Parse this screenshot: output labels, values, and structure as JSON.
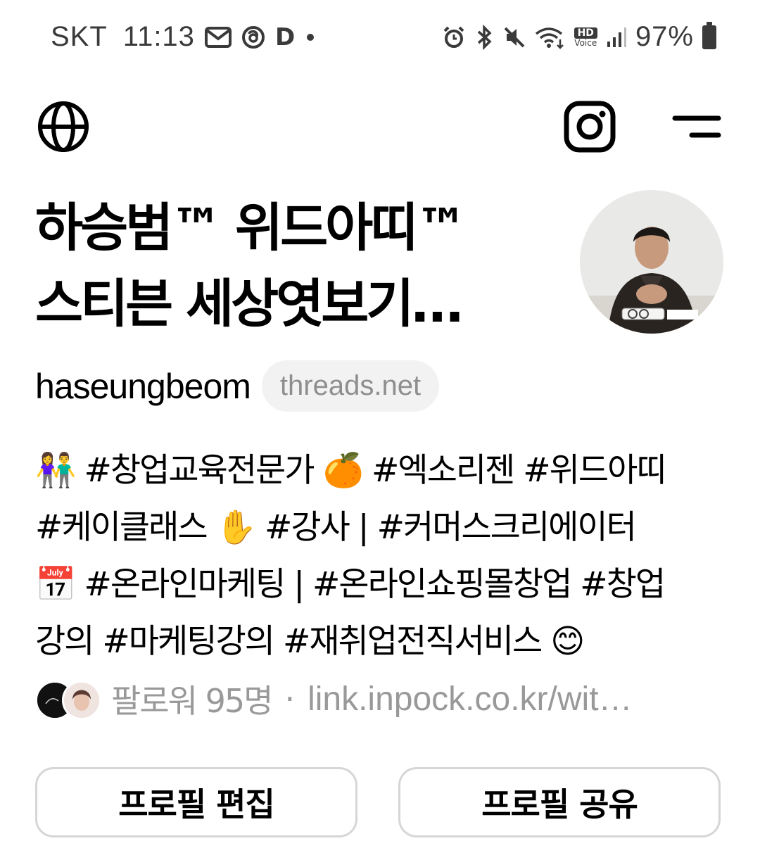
{
  "status_bar": {
    "carrier": "SKT",
    "time": "11:13",
    "d_badge": "D",
    "hd_voice_top": "HD",
    "hd_voice_bottom": "Voice",
    "battery": "97%"
  },
  "top_nav": {
    "language_icon": "globe-icon",
    "instagram_icon": "instagram-icon",
    "menu_icon": "menu-icon"
  },
  "profile": {
    "name_line1": "하승범™ 위드아띠™",
    "name_line2": "스티븐 세상엿보기…",
    "handle": "haseungbeom",
    "domain": "threads.net",
    "bio_lines": [
      {
        "emoji": "👫",
        "text": " #창업교육전문가 ",
        "emoji2": "🍊",
        "text2": " #엑소리젠 #위드아띠"
      },
      {
        "text": "#케이클래스 ",
        "emoji": "✋",
        "text2": " #강사 | #커머스크리에이터"
      },
      {
        "emoji": "📅",
        "text": " #온라인마케팅 | #온라인쇼핑몰창업 #창업"
      },
      {
        "text": "강의 #마케팅강의 #재취업전직서비스 ",
        "emoji": "😊"
      }
    ],
    "followers": "팔로워 95명",
    "separator": "·",
    "link": "link.inpock.co.kr/wit…"
  },
  "buttons": {
    "edit_profile": "프로필 편집",
    "share_profile": "프로필 공유"
  }
}
